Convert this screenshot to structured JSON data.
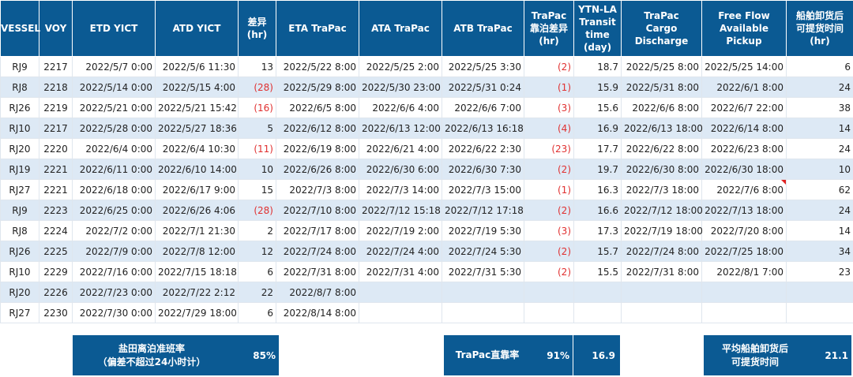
{
  "headers": [
    "VESSEL",
    "VOY",
    "ETD YICT",
    "ATD YICT",
    "差异\n(hr)",
    "ETA TraPac",
    "ATA TraPac",
    "ATB TraPac",
    "TraPac\n靠泊差异\n(hr)",
    "YTN-LA\nTransit\ntime\n(day)",
    "TraPac\nCargo Discharge",
    "Free Flow\nAvailable Pickup",
    "船舶卸货后\n可提货时间\n(hr)"
  ],
  "rows": [
    [
      "RJ9",
      "2217",
      "2022/5/7 0:00",
      "2022/5/6 11:30",
      "13",
      "2022/5/22 8:00",
      "2022/5/25 2:00",
      "2022/5/25 3:30",
      "(2)",
      "18.7",
      "2022/5/25 8:00",
      "2022/5/25 14:00",
      "6"
    ],
    [
      "RJ8",
      "2218",
      "2022/5/14 0:00",
      "2022/5/15 4:00",
      "(28)",
      "2022/5/29 8:00",
      "2022/5/30 23:00",
      "2022/5/31 0:24",
      "(1)",
      "15.9",
      "2022/5/31 8:00",
      "2022/6/1 8:00",
      "24"
    ],
    [
      "RJ26",
      "2219",
      "2022/5/21 0:00",
      "2022/5/21 15:42",
      "(16)",
      "2022/6/5 8:00",
      "2022/6/6 4:00",
      "2022/6/6 7:00",
      "(3)",
      "15.6",
      "2022/6/6 8:00",
      "2022/6/7 22:00",
      "38"
    ],
    [
      "RJ10",
      "2217",
      "2022/5/28 0:00",
      "2022/5/27 18:36",
      "5",
      "2022/6/12 8:00",
      "2022/6/13 12:00",
      "2022/6/13 16:18",
      "(4)",
      "16.9",
      "2022/6/13 18:00",
      "2022/6/14 8:00",
      "14"
    ],
    [
      "RJ20",
      "2220",
      "2022/6/4 0:00",
      "2022/6/4 10:30",
      "(11)",
      "2022/6/19 8:00",
      "2022/6/21 4:00",
      "2022/6/22 2:30",
      "(23)",
      "17.7",
      "2022/6/22 8:00",
      "2022/6/23 8:00",
      "24"
    ],
    [
      "RJ19",
      "2221",
      "2022/6/11 0:00",
      "2022/6/10 14:00",
      "10",
      "2022/6/26 8:00",
      "2022/6/30 6:00",
      "2022/6/30 7:30",
      "(2)",
      "19.7",
      "2022/6/30 8:00",
      "2022/6/30 18:00",
      "10"
    ],
    [
      "RJ27",
      "2221",
      "2022/6/18 0:00",
      "2022/6/17 9:00",
      "15",
      "2022/7/3 8:00",
      "2022/7/3 14:00",
      "2022/7/3 15:00",
      "(1)",
      "16.3",
      "2022/7/3 18:00",
      "2022/7/6 8:00",
      "62"
    ],
    [
      "RJ9",
      "2223",
      "2022/6/25 0:00",
      "2022/6/26 4:06",
      "(28)",
      "2022/7/10 8:00",
      "2022/7/12 15:18",
      "2022/7/12 17:18",
      "(2)",
      "16.6",
      "2022/7/12 18:00",
      "2022/7/13 18:00",
      "24"
    ],
    [
      "RJ8",
      "2224",
      "2022/7/2 0:00",
      "2022/7/1 21:30",
      "2",
      "2022/7/17 8:00",
      "2022/7/19 2:00",
      "2022/7/19 5:30",
      "(3)",
      "17.3",
      "2022/7/19 18:00",
      "2022/7/20 8:00",
      "14"
    ],
    [
      "RJ26",
      "2225",
      "2022/7/9 0:00",
      "2022/7/8 12:00",
      "12",
      "2022/7/24 8:00",
      "2022/7/24 4:00",
      "2022/7/24 5:30",
      "(2)",
      "15.7",
      "2022/7/24 8:00",
      "2022/7/25 18:00",
      "34"
    ],
    [
      "RJ10",
      "2229",
      "2022/7/16 0:00",
      "2022/7/15 18:18",
      "6",
      "2022/7/31 8:00",
      "2022/7/31 4:00",
      "2022/7/31 5:30",
      "(2)",
      "15.5",
      "2022/7/31 8:00",
      "2022/8/1 7:00",
      "23"
    ],
    [
      "RJ20",
      "2226",
      "2022/7/23 0:00",
      "2022/7/22 2:12",
      "22",
      "2022/8/7 8:00",
      "",
      "",
      "",
      "",
      "",
      "",
      ""
    ],
    [
      "RJ27",
      "2230",
      "2022/7/30 0:00",
      "2022/7/29 18:00",
      "6",
      "2022/8/14 8:00",
      "",
      "",
      "",
      "",
      "",
      "",
      ""
    ]
  ],
  "summary": {
    "yantian_label": "盐田离泊准班率\n（偏差不超过24小时计）",
    "yantian_value": "85%",
    "trapac_label": "TraPac直靠率",
    "trapac_value": "91%",
    "transit_avg": "16.9",
    "pickup_label": "平均船舶卸货后\n可提货时间",
    "pickup_value": "21.1"
  },
  "colors": {
    "header_bg": "#0b5a93",
    "band_bg": "#dde9f5",
    "negative_text": "#e03030"
  }
}
